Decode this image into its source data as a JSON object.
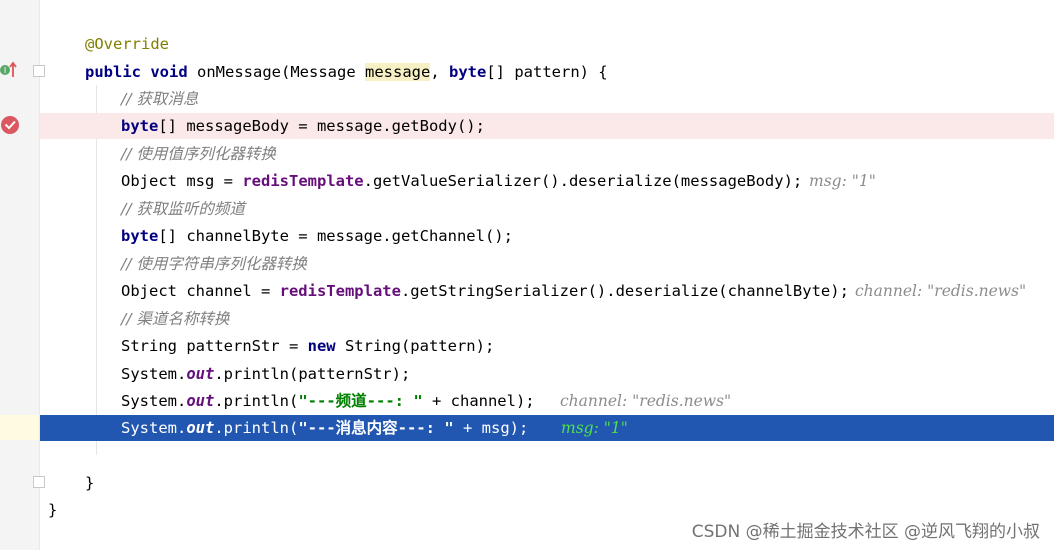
{
  "editor": {
    "code_lines": {
      "annotation": "@Override",
      "signature": {
        "kw1": "public",
        "kw2": "void",
        "name": "onMessage(Message ",
        "param": "message",
        "comma": ", ",
        "kw3": "byte",
        "rest": "[] pattern) {"
      },
      "comment_get_message": "// 获取消息",
      "body_line": {
        "kw": "byte",
        "rest": "[] messageBody = message.getBody();"
      },
      "comment_value_serializer": "// 使用值序列化器转换",
      "msg_line": {
        "pre": "Object msg = ",
        "field": "redisTemplate",
        "rest": ".getValueSerializer().deserialize(messageBody);",
        "hint": "msg: \"1\""
      },
      "comment_channel": "// 获取监听的频道",
      "channel_byte_line": {
        "kw": "byte",
        "rest": "[] channelByte = message.getChannel();"
      },
      "comment_string_serializer": "// 使用字符串序列化器转换",
      "channel_line": {
        "pre": "Object channel = ",
        "field": "redisTemplate",
        "rest": ".getStringSerializer().deserialize(channelByte);",
        "hint": "channel: \"redis.news\""
      },
      "comment_channel_name": "// 渠道名称转换",
      "pattern_line": {
        "pre": "String patternStr = ",
        "kw": "new",
        "rest": " String(pattern);"
      },
      "print_pattern": {
        "pre": "System.",
        "static": "out",
        "rest": ".println(patternStr);"
      },
      "print_channel": {
        "pre": "System.",
        "static": "out",
        "mid": ".println(",
        "str": "\"---频道---: \"",
        "rest": " + channel);",
        "hint": "channel: \"redis.news\""
      },
      "print_msg": {
        "pre": "System.",
        "static": "out",
        "mid": ".println(",
        "str": "\"---消息内容---: \"",
        "rest": " + msg);",
        "hint": "msg: \"1\""
      },
      "close_method": "}",
      "close_class": "}"
    }
  },
  "colors": {
    "keyword": "#000080",
    "annotation": "#808000",
    "comment": "#808080",
    "field": "#660e7a",
    "string": "#008000",
    "current_line_bg": "#2157b0",
    "error_line_bg": "#fbe8e8"
  },
  "icons": [
    "override-implement-icon",
    "breakpoint-icon",
    "fold-marker-icon"
  ],
  "watermark": "CSDN @稀土掘金技术社区 @逆风飞翔的小叔"
}
